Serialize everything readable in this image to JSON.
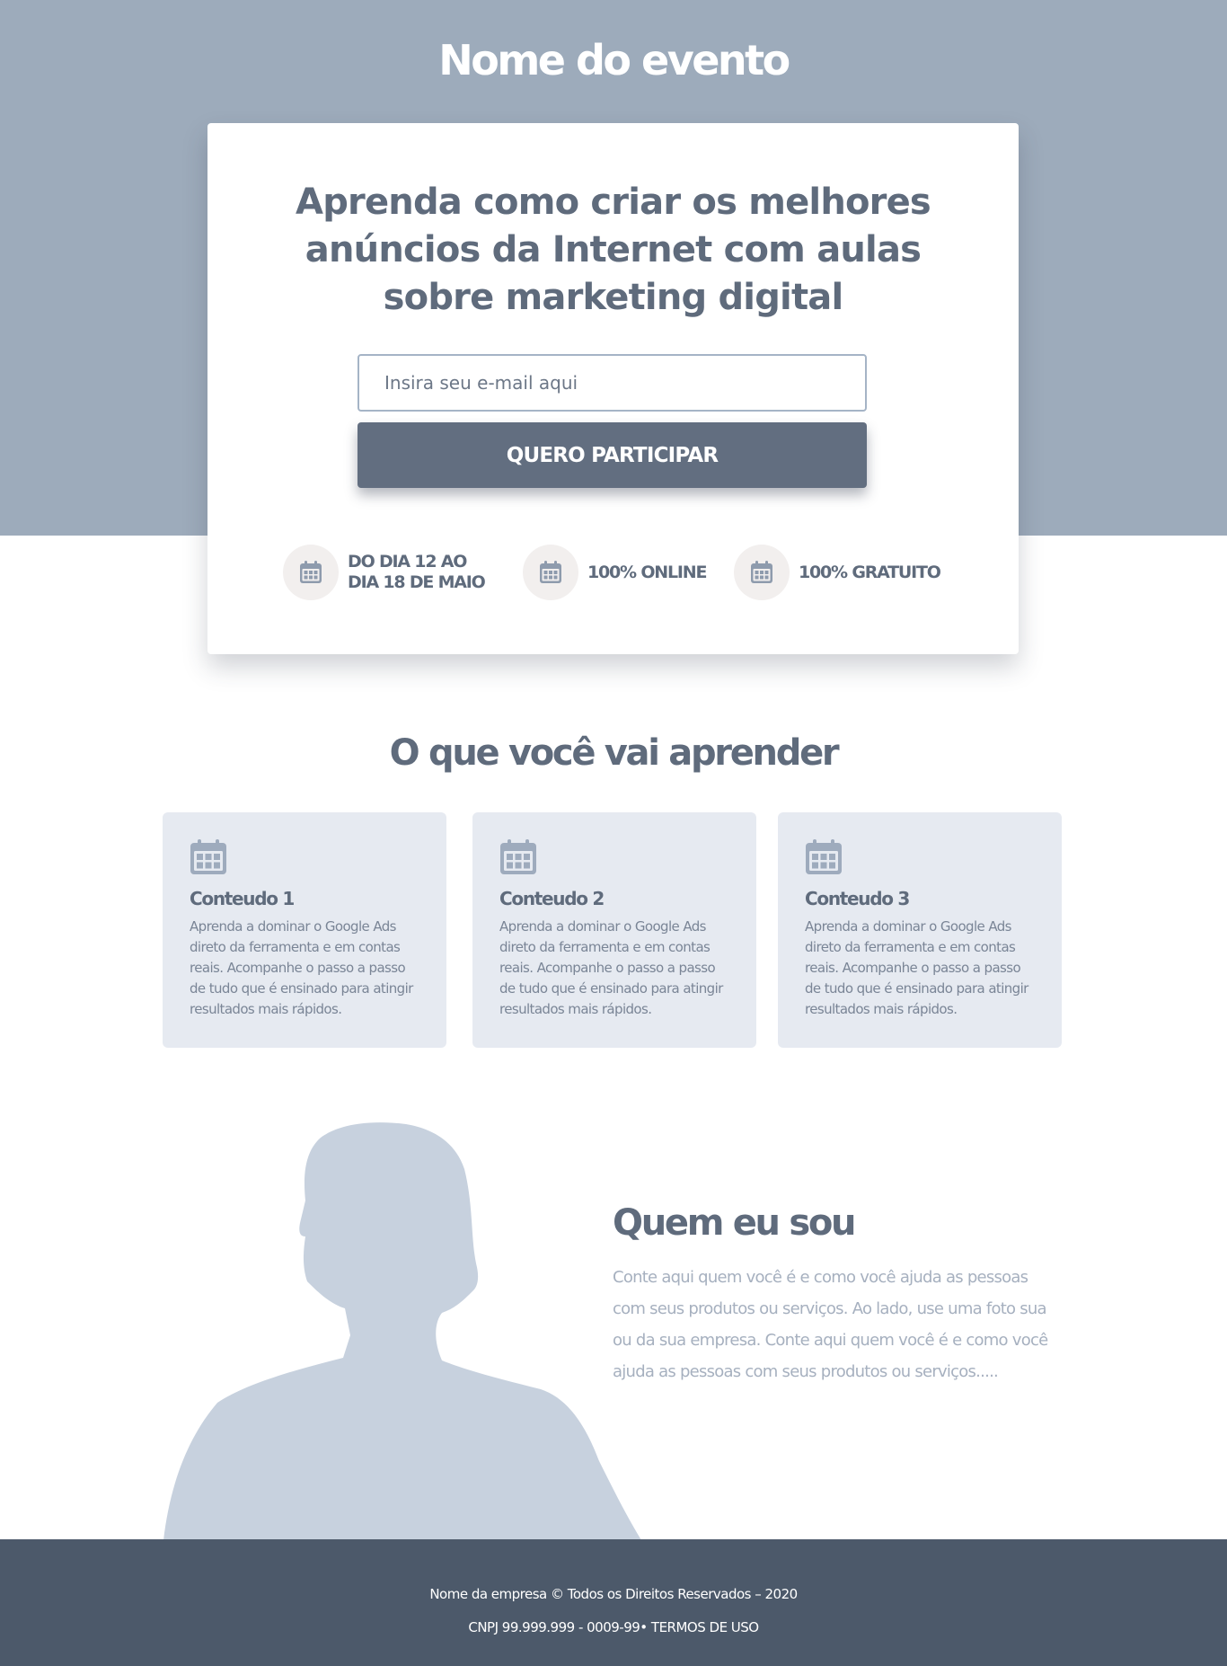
{
  "header": {
    "event_name": "Nome do evento",
    "headline": "Aprenda como criar os melhores anúncios da Internet com aulas sobre marketing digital"
  },
  "signup": {
    "email_placeholder": "Insira seu e-mail aqui",
    "cta_label": "QUERO PARTICIPAR"
  },
  "features": [
    {
      "icon": "calendar-icon",
      "line1": "DO DIA 12 AO",
      "line2": "DIA 18 DE MAIO"
    },
    {
      "icon": "calendar-icon",
      "line1": "100% ONLINE"
    },
    {
      "icon": "calendar-icon",
      "line1": "100% GRATUITO"
    }
  ],
  "learn": {
    "title": "O que você vai aprender",
    "cards": [
      {
        "icon": "calendar-icon",
        "title": "Conteudo 1",
        "text": "Aprenda a dominar o Google Ads direto da ferramenta e em contas reais. Acompanhe o passo a passo de tudo que é ensinado para atingir resultados mais rápidos."
      },
      {
        "icon": "calendar-icon",
        "title": "Conteudo 2",
        "text": "Aprenda a dominar o Google Ads direto da ferramenta e em contas reais. Acompanhe o passo a passo de tudo que é ensinado para atingir resultados mais rápidos."
      },
      {
        "icon": "calendar-icon",
        "title": "Conteudo 3",
        "text": "Aprenda a dominar o Google Ads direto da ferramenta e em contas reais. Acompanhe o passo a passo de tudo que é ensinado para atingir resultados mais rápidos."
      }
    ]
  },
  "about": {
    "title": "Quem eu sou",
    "text": "Conte aqui quem você é e como você ajuda as pessoas com seus produtos ou serviços. Ao lado, use uma foto sua ou da sua empresa. Conte aqui quem você é e como você ajuda as pessoas com seus produtos ou serviços.....",
    "image": "person-silhouette"
  },
  "footer": {
    "copyright": "Nome da empresa © Todos os Direitos Reservados – 2020",
    "legal": "CNPJ 99.999.999 - 0009-99• TERMOS DE USO"
  },
  "colors": {
    "hero_bg": "#9dabbb",
    "primary_text": "#5f6b7c",
    "cta_bg": "#626e80",
    "card_bg": "#e6eaf1",
    "footer_bg": "#4c596a",
    "silhouette": "#c7d1de"
  }
}
